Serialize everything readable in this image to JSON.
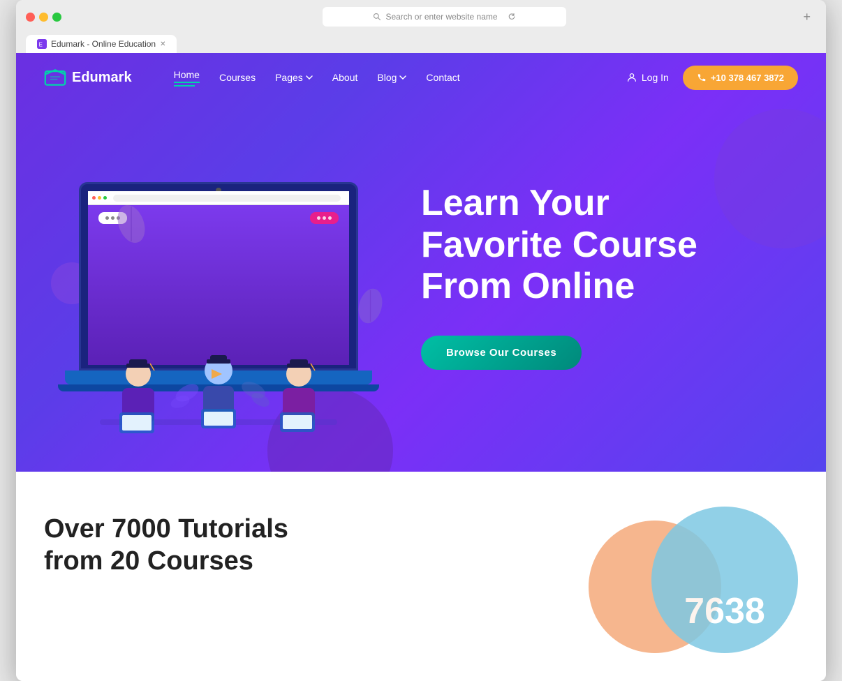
{
  "browser": {
    "tab_title": "Edumark - Online Education",
    "address": "Search or enter website name",
    "new_tab_label": "+"
  },
  "logo": {
    "text": "Edumark"
  },
  "nav": {
    "links": [
      {
        "label": "Home",
        "active": true
      },
      {
        "label": "Courses",
        "active": false
      },
      {
        "label": "Pages",
        "active": false,
        "has_dropdown": true
      },
      {
        "label": "About",
        "active": false
      },
      {
        "label": "Blog",
        "active": false,
        "has_dropdown": true
      },
      {
        "label": "Contact",
        "active": false
      }
    ],
    "login_label": "Log In",
    "phone_label": "+10 378 467 3872"
  },
  "hero": {
    "heading_line1": "Learn Your",
    "heading_line2": "Favorite Course",
    "heading_line3": "From Online",
    "browse_btn": "Browse Our Courses"
  },
  "stats": {
    "heading_line1": "Over 7000 Tutorials",
    "heading_line2": "from 20 Courses",
    "circle_number": "7638"
  },
  "colors": {
    "hero_gradient_start": "#6b2fe2",
    "hero_gradient_end": "#5544ee",
    "accent_teal": "#00bfa5",
    "accent_orange": "#f8a635",
    "circle_orange": "#f5a97a",
    "circle_blue": "#7ec8e3",
    "logo_color": "#7c3aed"
  }
}
